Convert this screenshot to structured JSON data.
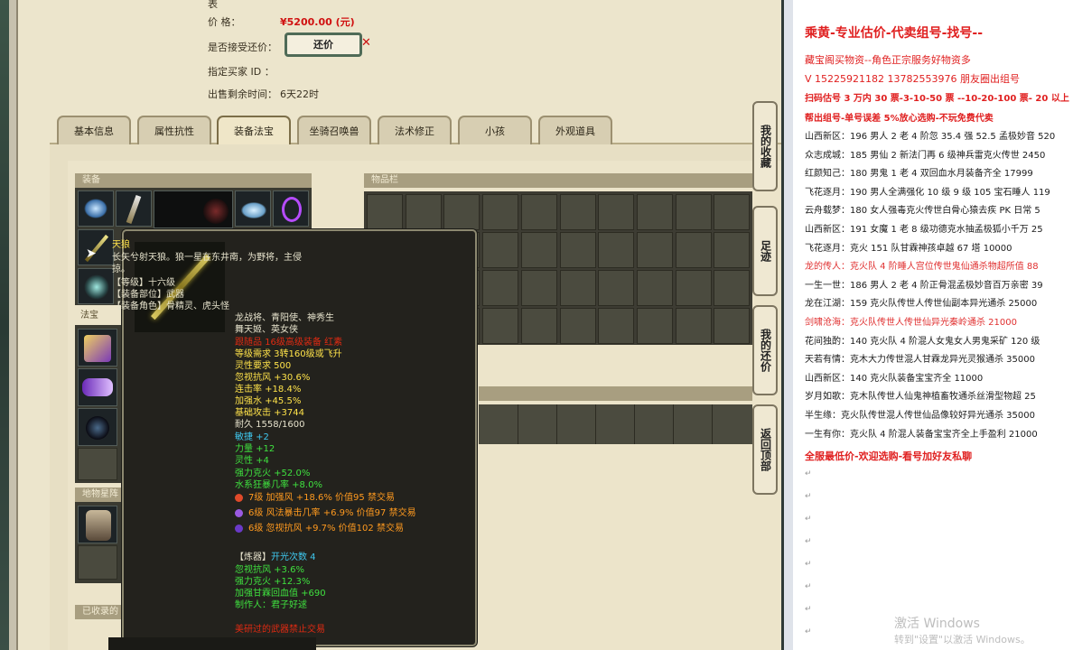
{
  "info": {
    "price_label": "价          格：",
    "price_value": "¥5200.00 (元)",
    "accept_counter_label": "是否接受还价：",
    "counter_button": "还价",
    "buyer_id_label": "指定买家 ID ：",
    "remaining_label": "出售剩余时间：",
    "remaining_value": "6天22时"
  },
  "tabs": [
    "基本信息",
    "属性抗性",
    "装备法宝",
    "坐骑召唤兽",
    "法术修正",
    "小孩",
    "外观道具"
  ],
  "active_tab": "装备法宝",
  "sections": {
    "equipment": "装备",
    "inventory": "物品栏",
    "fabao": "法宝",
    "other": "地物星阵",
    "collected": "已收录的"
  },
  "side_buttons": [
    "我的收藏",
    "足迹",
    "我的还价",
    "返回顶部"
  ],
  "tooltip": {
    "name": "天狼",
    "desc1": "长矢兮射天狼。狼一星在东井南，为野将，主侵",
    "desc2": "掠。",
    "level": "【等级】十六级",
    "slot": "【装备部位】武器",
    "role": "【装备角色】骨精灵、虎头怪",
    "role2": "龙战将、青阳使、神秀生",
    "role3": "舞天姬、英女侠",
    "origin": "跟随品 16级高级装备 红素",
    "req_level": "等级需求 3转160级或飞升",
    "spirit_req": "灵性要求 500",
    "ignore_res": "忽视抗风 +30.6%",
    "combo": "连击率 +18.4%",
    "water": "加强水 +45.5%",
    "base_atk": "基础攻击 +3744",
    "durability": "耐久 1558/1600",
    "agility": "敏捷 +2",
    "strength": "力量 +12",
    "spirit": "灵性 +4",
    "strong_ke": "强力克火 +52.0%",
    "water_crit": "水系狂暴几率 +8.0%",
    "gem1": "7级 加强风 +18.6% 价值95 禁交易",
    "gem2": "6级 风法暴击几率 +6.9% 价值97 禁交易",
    "gem3": "6级 忽视抗风 +9.7% 价值102 禁交易",
    "refine": "【炼器】",
    "refine_count": "开光次数 4",
    "r1": "忽视抗风 +3.6%",
    "r2": "强力克火 +12.3%",
    "r3": "加强甘霖回血值 +690",
    "maker": "制作人：君子好逑",
    "forbidden": "美研过的武器禁止交易"
  },
  "doc": {
    "title": "乘黄-专业估价-代卖组号-找号--",
    "l1": "藏宝阁买物资--角色正宗服务好物资多",
    "l2": "V 15225921182     13782553976  朋友圈出组号",
    "l3": "扫码估号 3 万内 30 票-3-10-50 票   --10-20-100 票- 20 以上",
    "l4": "帮出组号-单号误差 5%放心选购-不玩免费代卖",
    "rows": [
      {
        "text": "山西新区：196 男人 2 老 4 阶忽 35.4 强 52.5 孟极妙音 520",
        "color": "#1b1b1b"
      },
      {
        "text": "众志成城：185 男仙 2 新法门再 6 级神兵雷克火传世 2450",
        "color": "#1b1b1b"
      },
      {
        "text": "红颜知己：180 男鬼 1 老 4 双回血水月装备齐全 17999",
        "color": "#1b1b1b"
      },
      {
        "text": "飞花逐月：190 男人全满强化 10 级 9 级 105 宝石睡人 119",
        "color": "#1b1b1b"
      },
      {
        "text": "云舟载梦：180 女人强毒克火传世白骨心猿去疾 PK 日常 5",
        "color": "#1b1b1b"
      },
      {
        "text": "山西新区：191 女魔 1 老 8 级功德克水抽孟极狐小千万 25",
        "color": "#1b1b1b"
      },
      {
        "text": "飞花逐月：克火 151 队甘霖神孩卓越 67 塔 10000",
        "color": "#1b1b1b"
      },
      {
        "text": "龙的传人：克火队 4 阶睡人宫位传世鬼仙通杀物超所值 88",
        "color": "#e03030"
      },
      {
        "text": "一生一世：186 男人 2 老 4 阶正骨混孟极妙音百万亲密 39",
        "color": "#1b1b1b"
      },
      {
        "text": "龙在江湖：159 克火队传世人传世仙副本异光通杀 25000",
        "color": "#1b1b1b"
      },
      {
        "text": "剑啸沧海：克火队传世人传世仙异光秦岭通杀 21000",
        "color": "#e03030"
      },
      {
        "text": "花间独酌：140 克火队 4 阶混人女鬼女人男鬼采矿 120 级",
        "color": "#1b1b1b"
      },
      {
        "text": "天若有情：克木大力传世混人甘霖龙异光灵猴通杀 35000",
        "color": "#1b1b1b"
      },
      {
        "text": "山西新区：140 克火队装备宝宝齐全 11000",
        "color": "#1b1b1b"
      },
      {
        "text": "岁月如歌：克木队传世人仙鬼神植畜牧通杀丝滑型物超 25",
        "color": "#1b1b1b"
      },
      {
        "text": "半生缘：克火队传世混人传世仙品像较好异光通杀 35000",
        "color": "#1b1b1b"
      },
      {
        "text": "一生有你：克火队 4 阶混人装备宝宝齐全上手盈利 21000",
        "color": "#1b1b1b"
      }
    ],
    "footer": "全服最低价-欢迎选购-看号加好友私聊",
    "return_mark": "↵"
  },
  "watermark": {
    "line1": "激活 Windows",
    "line2": "转到\"设置\"以激活 Windows。"
  }
}
